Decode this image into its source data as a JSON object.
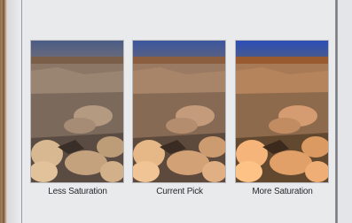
{
  "variations": [
    {
      "label": "Less Saturation"
    },
    {
      "label": "Current Pick"
    },
    {
      "label": "More Saturation"
    }
  ]
}
